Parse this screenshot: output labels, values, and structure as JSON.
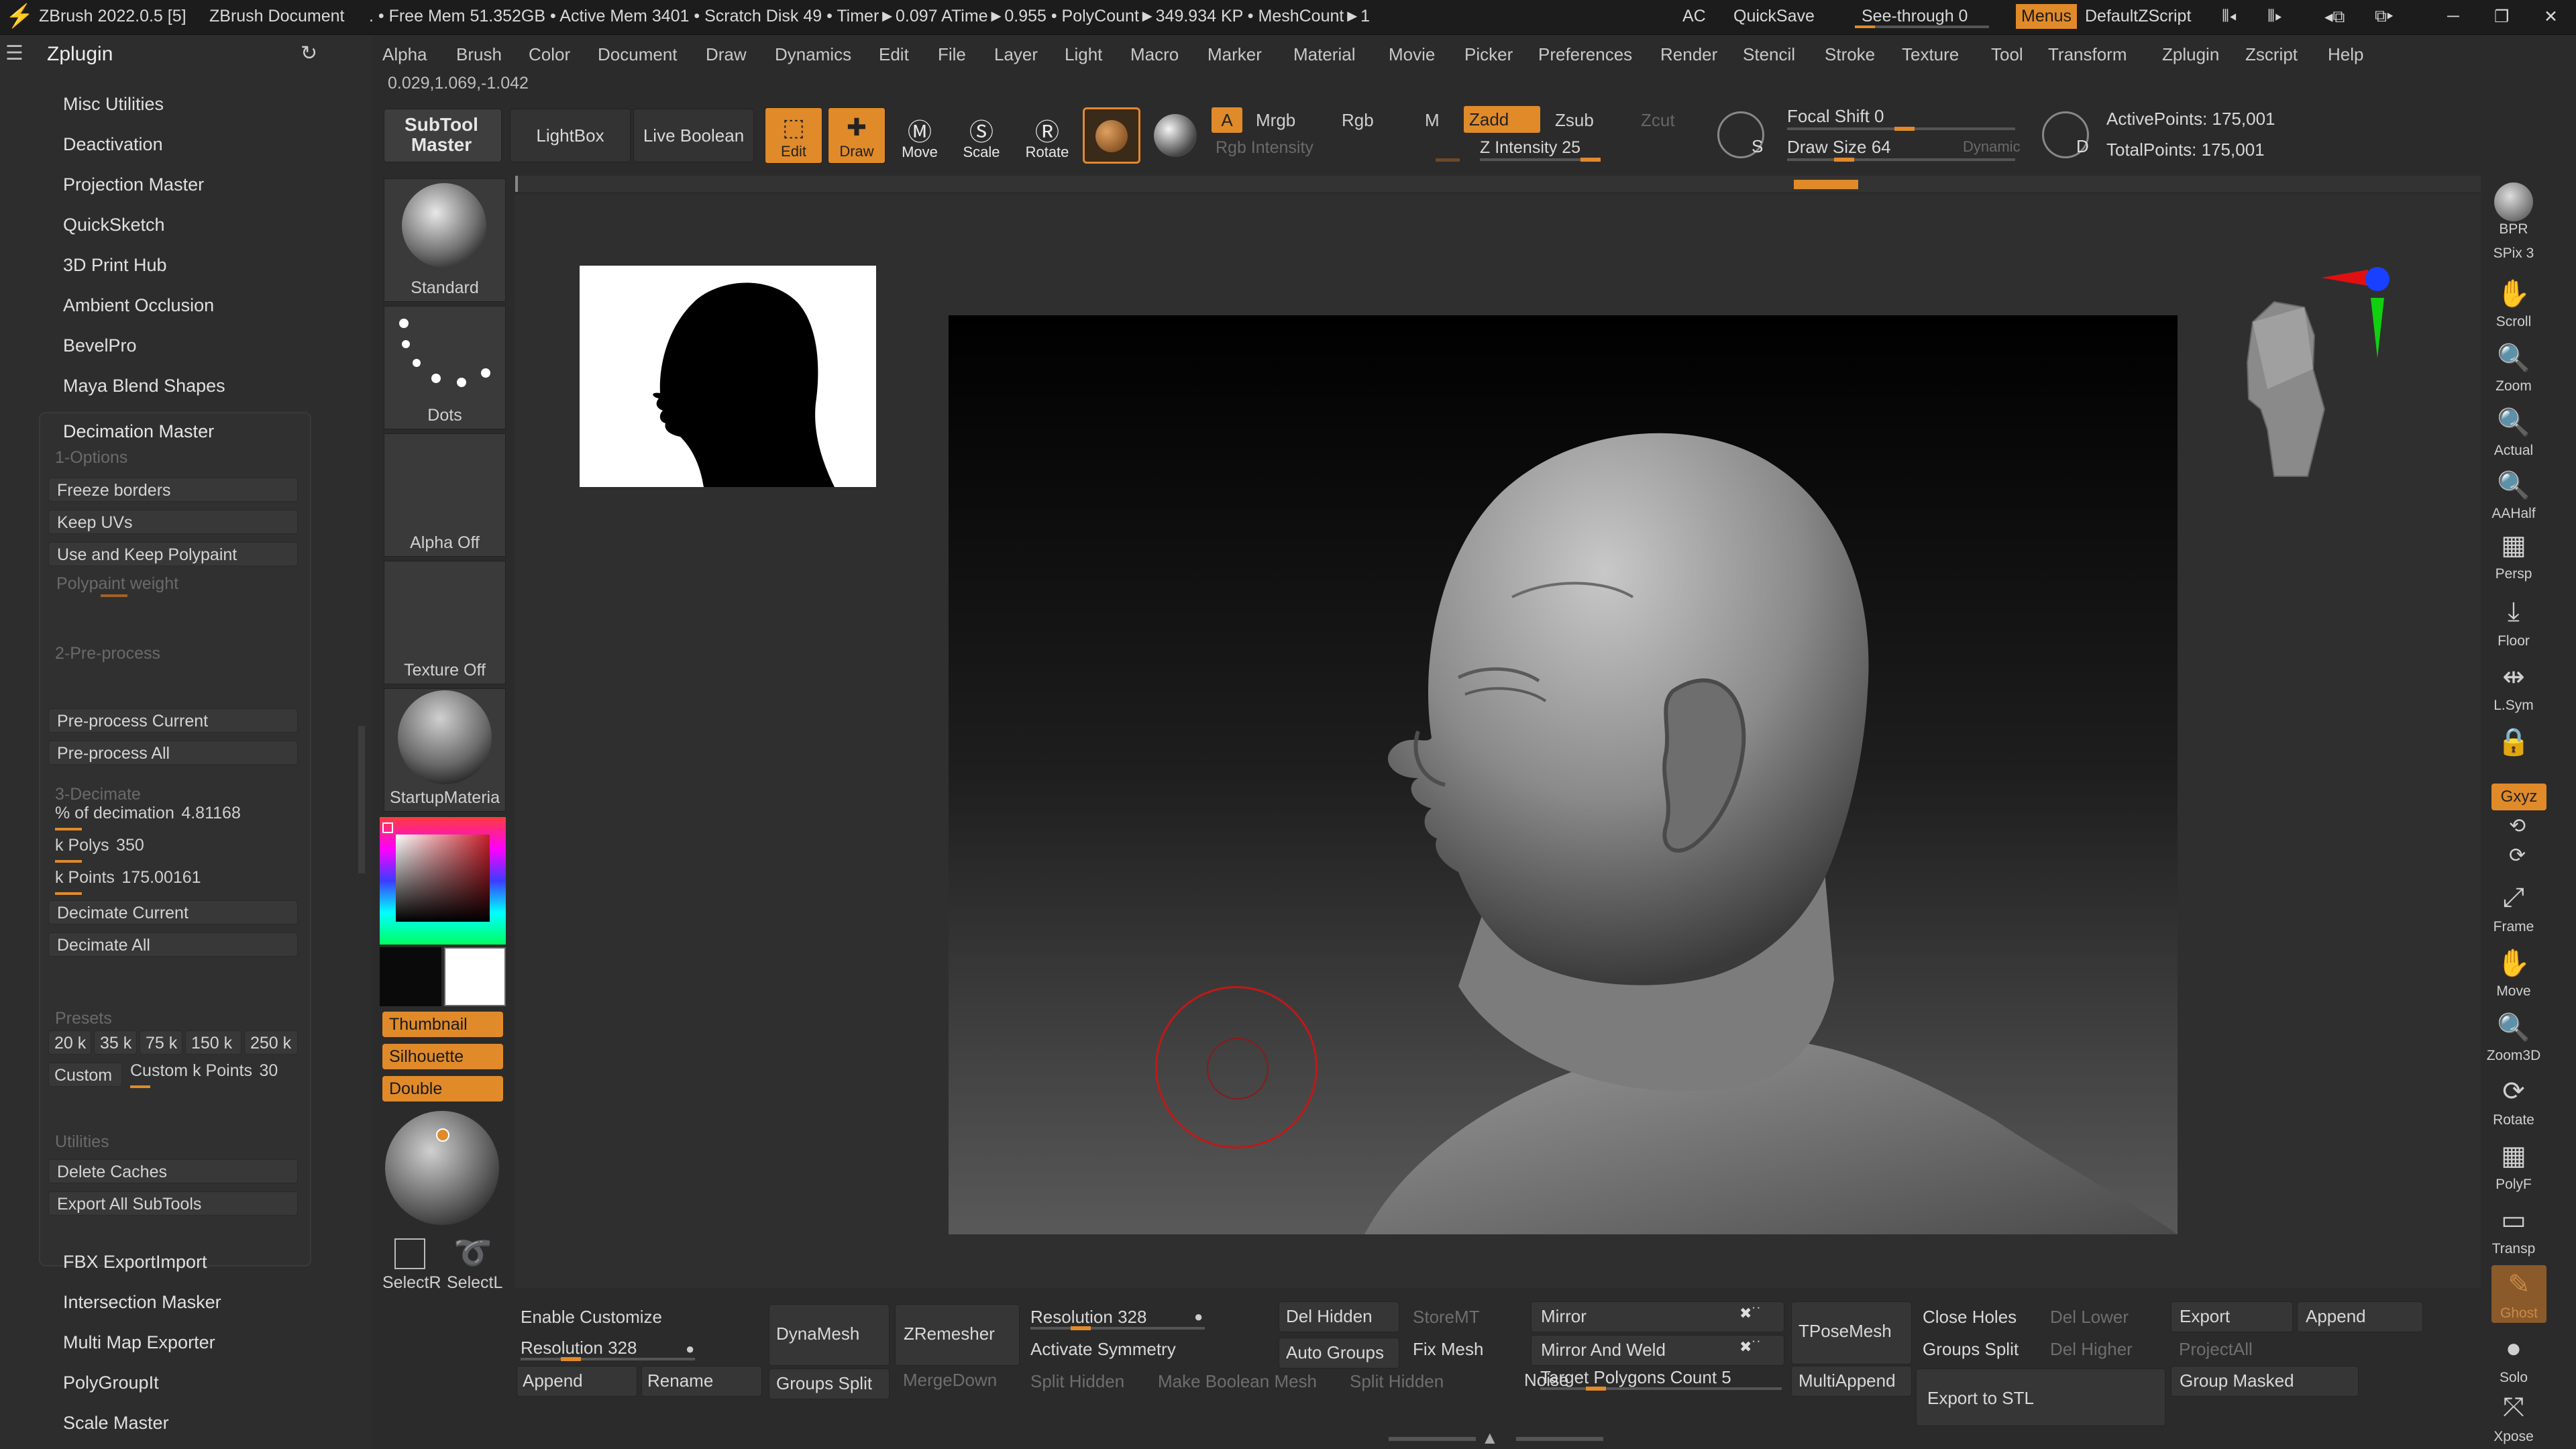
{
  "titlebar": {
    "app": "ZBrush 2022.0.5 [5]",
    "doc": "ZBrush Document",
    "stats": ". • Free Mem 51.352GB • Active Mem 3401 • Scratch Disk 49 • Timer►0.097 ATime►0.955 • PolyCount►349.934 KP • MeshCount►1",
    "ac": "AC",
    "quicksave": "QuickSave",
    "see_through": "See-through  0",
    "menus": "Menus",
    "script": "DefaultZScript"
  },
  "coords": "0.029,1.069,-1.042",
  "menu": [
    "Alpha",
    "Brush",
    "Color",
    "Document",
    "Draw",
    "Dynamics",
    "Edit",
    "File",
    "Layer",
    "Light",
    "Macro",
    "Marker",
    "Material",
    "Movie",
    "Picker",
    "Preferences",
    "Render",
    "Stencil",
    "Stroke",
    "Texture",
    "Tool",
    "Transform",
    "Zplugin",
    "Zscript",
    "Help"
  ],
  "zplugin": {
    "title": "Zplugin",
    "items_top": [
      "Misc Utilities",
      "Deactivation",
      "Projection Master",
      "QuickSketch",
      "3D Print Hub",
      "Ambient Occlusion",
      "BevelPro",
      "Maya Blend Shapes"
    ],
    "decimation": {
      "title": "Decimation Master",
      "options_label": "1-Options",
      "freeze": "Freeze borders",
      "keep_uvs": "Keep UVs",
      "keep_poly": "Use and Keep Polypaint",
      "poly_weight": "Polypaint weight",
      "preprocess_label": "2-Pre-process",
      "pre_current": "Pre-process Current",
      "pre_all": "Pre-process All",
      "decimate_label": "3-Decimate",
      "pct_label": "% of decimation",
      "pct_value": "4.81168",
      "kpolys_label": "k Polys",
      "kpolys_value": "350",
      "kpoints_label": "k Points",
      "kpoints_value": "175.00161",
      "dec_current": "Decimate Current",
      "dec_all": "Decimate All",
      "presets_label": "Presets",
      "presets": [
        "20 k",
        "35 k",
        "75 k",
        "150 k",
        "250 k"
      ],
      "custom": "Custom",
      "custom_kpoints_label": "Custom k Points",
      "custom_kpoints_value": "30",
      "utilities_label": "Utilities",
      "delete_caches": "Delete Caches",
      "export_all": "Export All SubTools"
    },
    "items_bottom": [
      "FBX ExportImport",
      "Intersection Masker",
      "Multi Map Exporter",
      "PolyGroupIt",
      "Scale Master"
    ]
  },
  "palette": {
    "standard": "Standard",
    "dots": "Dots",
    "alpha_off": "Alpha Off",
    "texture_off": "Texture Off",
    "material": "StartupMateria",
    "thumbnail": "Thumbnail",
    "silhouette": "Silhouette",
    "double": "Double",
    "selectr": "SelectR",
    "selectl": "SelectL"
  },
  "toolbar": {
    "subtool_master": "SubTool Master",
    "lightbox": "LightBox",
    "live_boolean": "Live Boolean",
    "edit": "Edit",
    "draw": "Draw",
    "move": "Move",
    "scale": "Scale",
    "rotate": "Rotate",
    "a": "A",
    "mrgb": "Mrgb",
    "rgb": "Rgb",
    "m": "M",
    "zadd": "Zadd",
    "zsub": "Zsub",
    "zcut": "Zcut",
    "rgb_intensity": "Rgb Intensity",
    "z_intensity": "Z Intensity 25",
    "focal_shift": "Focal Shift 0",
    "draw_size": "Draw Size 64",
    "dynamic": "Dynamic",
    "active_points": "ActivePoints: 175,001",
    "total_points": "TotalPoints: 175,001"
  },
  "shelf": [
    {
      "icon": "bpr-icon",
      "label": "BPR"
    },
    {
      "icon": "spix-icon",
      "label": "SPix 3"
    },
    {
      "icon": "scroll-icon",
      "label": "Scroll"
    },
    {
      "icon": "zoom-icon",
      "label": "Zoom"
    },
    {
      "icon": "actual-icon",
      "label": "Actual"
    },
    {
      "icon": "aahalf-icon",
      "label": "AAHalf"
    },
    {
      "icon": "persp-icon",
      "label": "Persp"
    },
    {
      "icon": "floor-icon",
      "label": "Floor"
    },
    {
      "icon": "lsym-icon",
      "label": "L.Sym"
    },
    {
      "icon": "lock-icon",
      "label": ""
    },
    {
      "icon": "gxyz-icon",
      "label": "Gxyz"
    },
    {
      "icon": "frame-icon",
      "label": "Frame"
    },
    {
      "icon": "move-icon",
      "label": "Move"
    },
    {
      "icon": "zoom3d-icon",
      "label": "Zoom3D"
    },
    {
      "icon": "rotate-icon",
      "label": "Rotate"
    },
    {
      "icon": "polyf-icon",
      "label": "PolyF"
    },
    {
      "icon": "transp-icon",
      "label": "Transp"
    },
    {
      "icon": "ghost-icon",
      "label": "Ghost"
    },
    {
      "icon": "solo-icon",
      "label": "Solo"
    },
    {
      "icon": "xpose-icon",
      "label": "Xpose"
    }
  ],
  "bottom": {
    "enable_customize": "Enable Customize",
    "resolution1": "Resolution 328",
    "append1": "Append",
    "rename": "Rename",
    "dynamesh": "DynaMesh",
    "groups_split1": "Groups Split",
    "zremesher": "ZRemesher",
    "mergedown": "MergeDown",
    "resolution2": "Resolution 328",
    "activate_symmetry": "Activate Symmetry",
    "split_hidden1": "Split Hidden",
    "make_boolean": "Make Boolean Mesh",
    "del_hidden": "Del Hidden",
    "auto_groups": "Auto Groups",
    "split_hidden2": "Split Hidden",
    "storemt": "StoreMT",
    "fix_mesh": "Fix Mesh",
    "noise": "Noise",
    "mirror": "Mirror",
    "mirror_weld": "Mirror And Weld",
    "target_poly": "Target Polygons Count 5",
    "tposemesh": "TPoseMesh",
    "multiappend": "MultiAppend",
    "close_holes": "Close Holes",
    "groups_split2": "Groups Split",
    "export_stl": "Export to STL",
    "del_lower": "Del Lower",
    "del_higher": "Del Higher",
    "export": "Export",
    "append2": "Append",
    "projectall": "ProjectAll",
    "group_masked": "Group Masked"
  }
}
